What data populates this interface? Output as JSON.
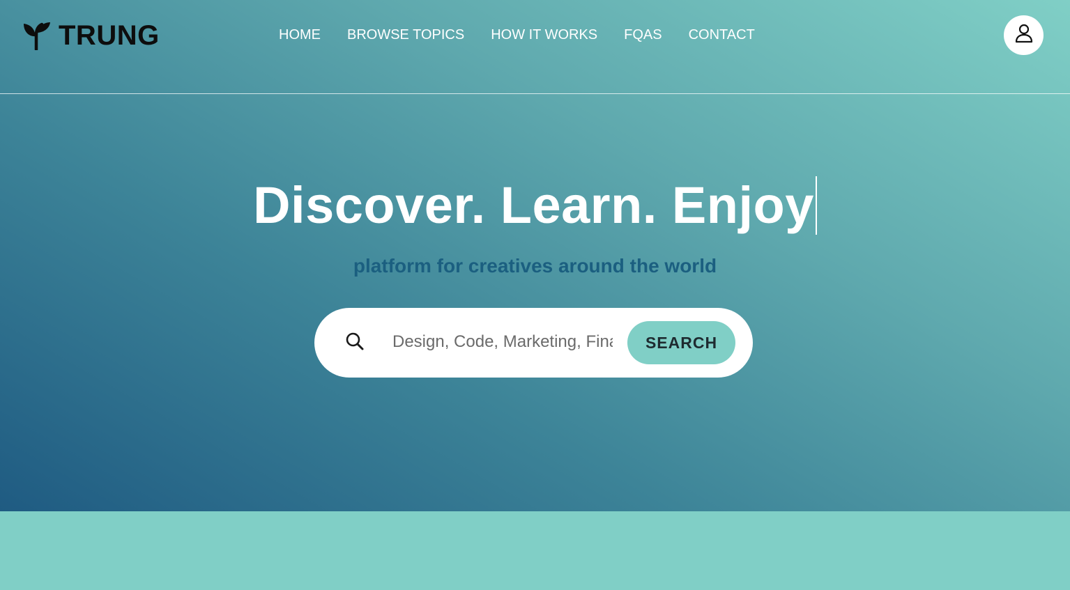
{
  "brand": {
    "name": "TRUNG",
    "icon": "sprout-icon"
  },
  "nav": {
    "items": [
      {
        "label": "HOME"
      },
      {
        "label": "BROWSE TOPICS"
      },
      {
        "label": "HOW IT WORKS"
      },
      {
        "label": "FQAS"
      },
      {
        "label": "CONTACT"
      }
    ]
  },
  "profile": {
    "icon": "user-icon"
  },
  "hero": {
    "headline": "Discover. Learn. Enjoy",
    "subtitle": "platform for creatives around the world"
  },
  "search": {
    "icon": "search-icon",
    "placeholder": "Design, Code, Marketing, Finance ...",
    "value": "",
    "button_label": "SEARCH"
  },
  "colors": {
    "gradient_dark": "#1f5b82",
    "gradient_light": "#80cfc6",
    "accent": "#80cfc6",
    "subtitle": "#1b5f80"
  }
}
